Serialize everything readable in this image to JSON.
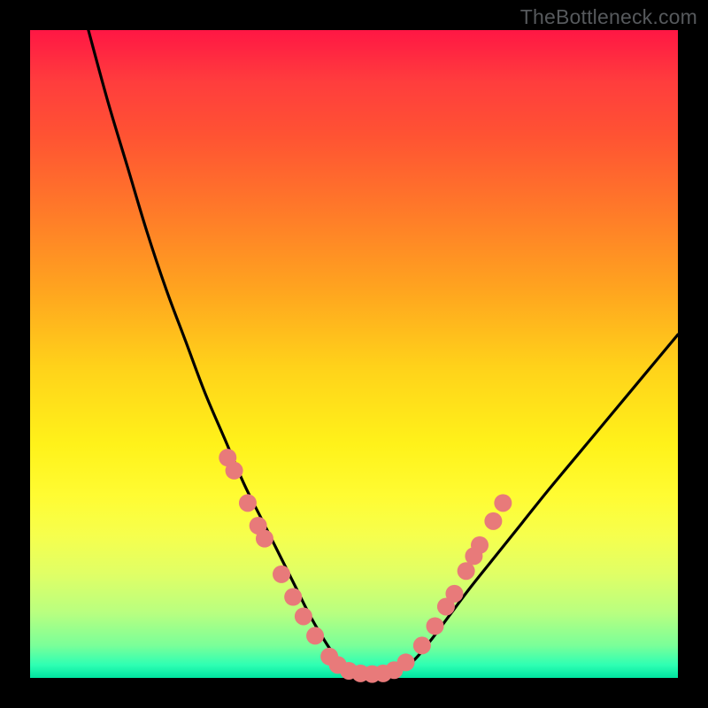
{
  "watermark": "TheBottleneck.com",
  "colors": {
    "frame": "#000000",
    "curve_stroke": "#000000",
    "marker_fill": "#e87a7a",
    "marker_stroke": "#cf5a5a"
  },
  "chart_data": {
    "type": "line",
    "title": "",
    "xlabel": "",
    "ylabel": "",
    "xlim": [
      0,
      100
    ],
    "ylim": [
      0,
      100
    ],
    "grid": false,
    "legend": false,
    "series": [
      {
        "name": "curve",
        "x": [
          9,
          12,
          15,
          18,
          21,
          24,
          27,
          30,
          33,
          36,
          39,
          41,
          43,
          45,
          47,
          49,
          51,
          53,
          56,
          59,
          62,
          65,
          68,
          72,
          76,
          80,
          85,
          90,
          95,
          100
        ],
        "y": [
          100,
          89,
          79,
          69,
          60,
          52,
          44,
          37,
          30,
          24,
          18,
          14,
          10,
          6.5,
          3.5,
          1.5,
          0.7,
          0.6,
          0.8,
          2.5,
          6,
          10,
          14,
          19,
          24,
          29,
          35,
          41,
          47,
          53
        ]
      }
    ],
    "markers": [
      {
        "x": 30.5,
        "y": 34
      },
      {
        "x": 31.5,
        "y": 32
      },
      {
        "x": 33.6,
        "y": 27
      },
      {
        "x": 35.2,
        "y": 23.5
      },
      {
        "x": 36.2,
        "y": 21.5
      },
      {
        "x": 38.8,
        "y": 16
      },
      {
        "x": 40.6,
        "y": 12.5
      },
      {
        "x": 42.2,
        "y": 9.5
      },
      {
        "x": 44.0,
        "y": 6.5
      },
      {
        "x": 46.2,
        "y": 3.3
      },
      {
        "x": 47.5,
        "y": 2.0
      },
      {
        "x": 49.2,
        "y": 1.1
      },
      {
        "x": 51.0,
        "y": 0.7
      },
      {
        "x": 52.8,
        "y": 0.6
      },
      {
        "x": 54.5,
        "y": 0.7
      },
      {
        "x": 56.2,
        "y": 1.2
      },
      {
        "x": 58.0,
        "y": 2.4
      },
      {
        "x": 60.5,
        "y": 5.0
      },
      {
        "x": 62.5,
        "y": 8.0
      },
      {
        "x": 64.2,
        "y": 11.0
      },
      {
        "x": 65.5,
        "y": 13.0
      },
      {
        "x": 67.3,
        "y": 16.5
      },
      {
        "x": 68.5,
        "y": 18.8
      },
      {
        "x": 69.4,
        "y": 20.5
      },
      {
        "x": 71.5,
        "y": 24.2
      },
      {
        "x": 73.0,
        "y": 27.0
      }
    ],
    "grad_top": "#ff1744",
    "grad_bottom": "#00e4a0"
  }
}
